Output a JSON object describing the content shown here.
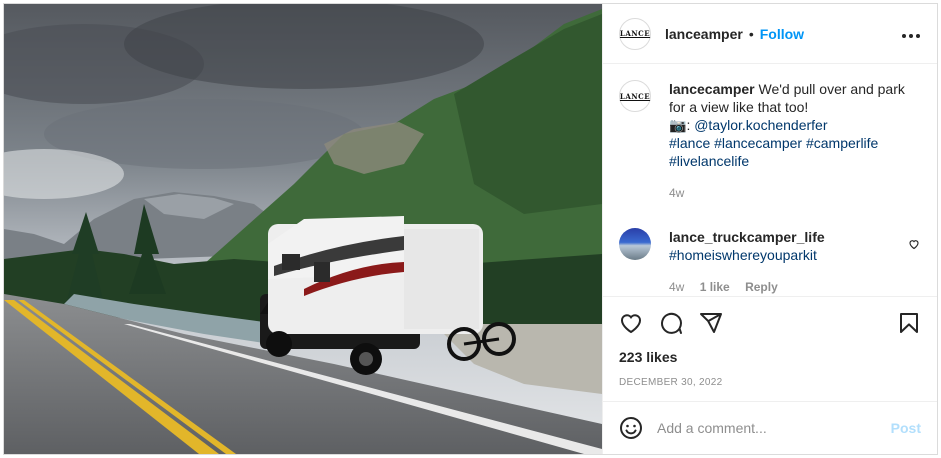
{
  "post": {
    "account": "lanceamper",
    "avatar_text": "LANCE",
    "separator": "•",
    "follow_label": "Follow",
    "more_label": "•••"
  },
  "caption": {
    "username": "lancecamper",
    "text": "We'd pull over and park for a view like that too!",
    "camera_emoji": "📷",
    "credit_prefix": ": ",
    "credit_handle": "@taylor.kochenderfer",
    "hashtags_line1": "#lance #lancecamper #camperlife",
    "hashtags_line2": "#livelancelife",
    "time": "4w"
  },
  "comments": [
    {
      "username": "lance_truckcamper_life",
      "text": "#homeiswhereyouparkit",
      "time": "4w",
      "likes": "1 like",
      "reply_label": "Reply"
    }
  ],
  "engagement": {
    "likes_text": "223 likes",
    "date_text": "DECEMBER 30, 2022"
  },
  "composer": {
    "placeholder": "Add a comment...",
    "post_label": "Post"
  },
  "icons": [
    "heart-icon",
    "comment-icon",
    "share-icon",
    "bookmark-icon",
    "emoji-icon",
    "more-icon"
  ],
  "colors": {
    "link": "#0095f6",
    "hashtag": "#00376b",
    "muted": "#8e8e8e",
    "post_disabled": "#b2dffc"
  }
}
